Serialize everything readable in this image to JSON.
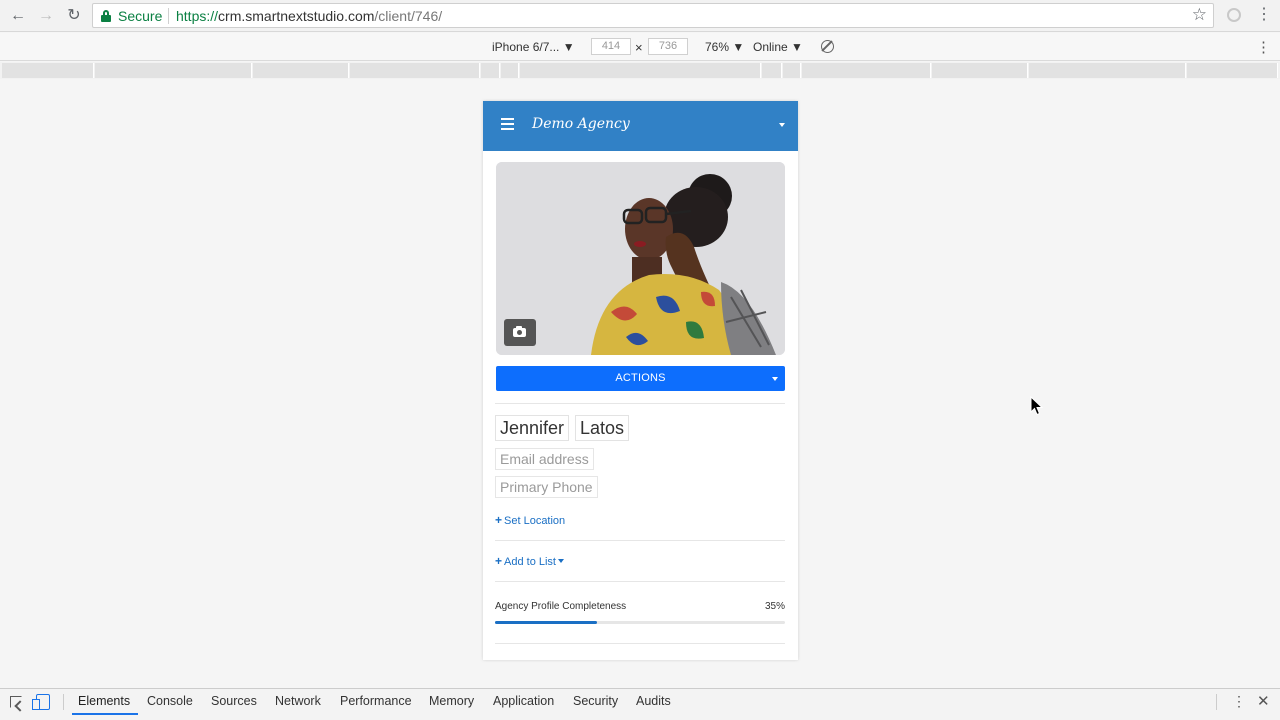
{
  "browser": {
    "secure_label": "Secure",
    "url_scheme": "https://",
    "url_host": "crm.smartnextstudio.com",
    "url_path": "/client/746/",
    "back_icon": "arrow-left-icon",
    "forward_icon": "arrow-right-icon",
    "reload_icon": "reload-icon",
    "bookmark_icon": "star-icon"
  },
  "device_toolbar": {
    "device": "iPhone 6/7... ▼",
    "width": "414",
    "height": "736",
    "times": "×",
    "zoom": "76% ▼",
    "throttle": "Online ▼"
  },
  "app": {
    "brand": "Demo Agency",
    "header_color": "#3181c6",
    "actions_label": "ACTIONS",
    "actions_color": "#0d6efd",
    "first_name": "Jennifer",
    "last_name": "Latos",
    "email_placeholder": "Email address",
    "phone_placeholder": "Primary Phone",
    "set_location_label": "Set Location",
    "add_to_list_label": "Add to List",
    "completeness_label": "Agency Profile Completeness",
    "completeness_pct": "35%",
    "completeness_value": 0.35
  },
  "devtools": {
    "tabs": [
      "Elements",
      "Console",
      "Sources",
      "Network",
      "Performance",
      "Memory",
      "Application",
      "Security",
      "Audits"
    ],
    "active_tab": "Elements"
  }
}
